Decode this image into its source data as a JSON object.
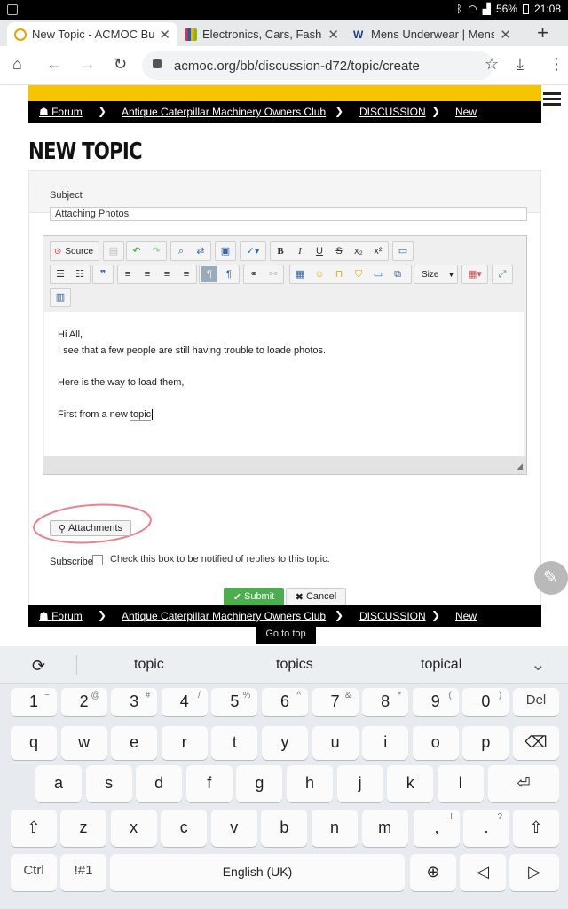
{
  "status_bar": {
    "battery": "56%",
    "time": "21:08"
  },
  "tabs": [
    {
      "title": "New Topic - ACMOC Bull",
      "active": true
    },
    {
      "title": "Electronics, Cars, Fashio",
      "active": false
    },
    {
      "title": "Mens Underwear | Mens",
      "active": false
    }
  ],
  "address_bar": {
    "url": "acmoc.org/bb/discussion-d72/topic/create"
  },
  "breadcrumb": {
    "items": [
      "Forum",
      "Antique Caterpillar Machinery Owners Club",
      "DISCUSSION",
      "New"
    ]
  },
  "page_title": "NEW TOPIC",
  "form": {
    "subject_label": "Subject",
    "subject_value": "Attaching Photos",
    "toolbar": {
      "source_label": "Source",
      "size_label": "Size"
    },
    "editor_lines": [
      "Hi All,",
      "I see that a few people are still having trouble to loade photos.",
      "",
      "Here is the way to load them,",
      "",
      "First from a new topic"
    ],
    "attachments_label": "Attachments",
    "subscribe_label": "Subscribe",
    "subscribe_desc": "Check this box to be notified of replies to this topic.",
    "submit_label": "Submit",
    "cancel_label": "Cancel"
  },
  "go_to_top": "Go to top",
  "keyboard": {
    "suggestions": [
      "topic",
      "topics",
      "topical"
    ],
    "number_row": [
      {
        "k": "1",
        "s": "~"
      },
      {
        "k": "2",
        "s": "@"
      },
      {
        "k": "3",
        "s": "#"
      },
      {
        "k": "4",
        "s": "/"
      },
      {
        "k": "5",
        "s": "%"
      },
      {
        "k": "6",
        "s": "^"
      },
      {
        "k": "7",
        "s": "&"
      },
      {
        "k": "8",
        "s": "*"
      },
      {
        "k": "9",
        "s": "("
      },
      {
        "k": "0",
        "s": ")"
      },
      {
        "k": "Del",
        "s": ""
      }
    ],
    "row_q": [
      "q",
      "w",
      "e",
      "r",
      "t",
      "y",
      "u",
      "i",
      "o",
      "p"
    ],
    "row_a": [
      "a",
      "s",
      "d",
      "f",
      "g",
      "h",
      "j",
      "k",
      "l"
    ],
    "row_z": [
      "z",
      "x",
      "c",
      "v",
      "b",
      "n",
      "m"
    ],
    "comma_sup": "!",
    "period_sup": "?",
    "ctrl_label": "Ctrl",
    "sym_label": "!#1",
    "space_label": "English (UK)"
  },
  "colors": {
    "accent_yellow": "#f7c400",
    "submit_green": "#4cae4c",
    "annotation_red": "#e8828c"
  }
}
